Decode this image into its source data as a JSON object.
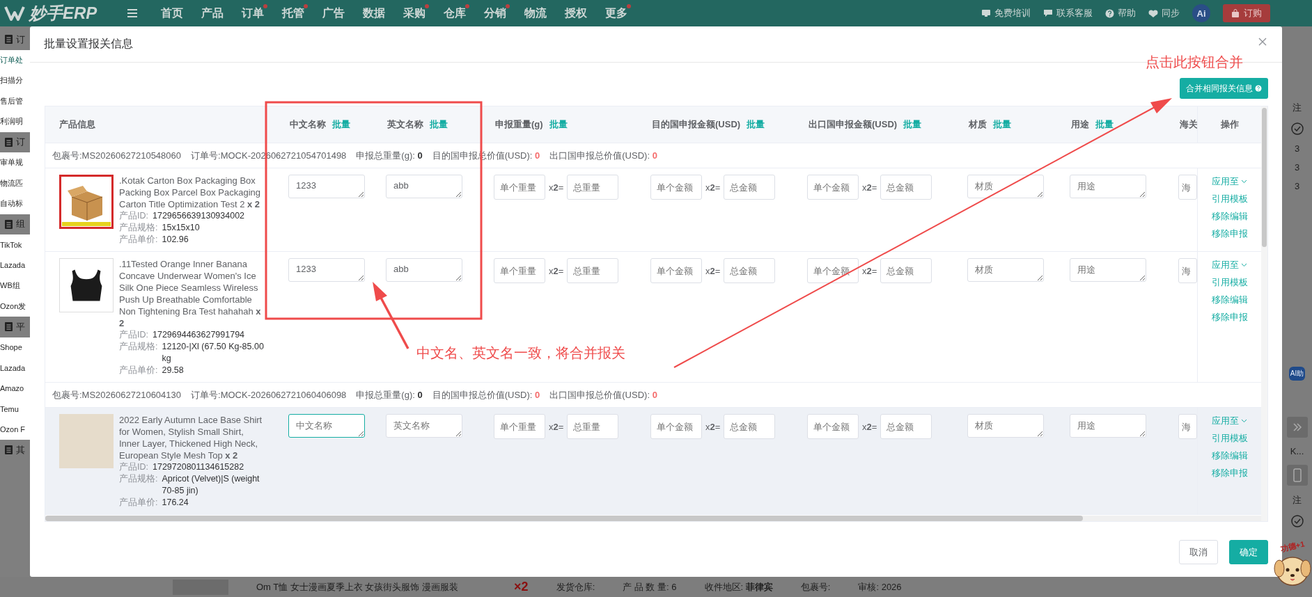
{
  "topbar": {
    "logo": "妙手ERP",
    "nav": [
      {
        "label": "首页",
        "badge": false
      },
      {
        "label": "产品",
        "badge": false
      },
      {
        "label": "订单",
        "badge": true
      },
      {
        "label": "托管",
        "badge": true
      },
      {
        "label": "广告",
        "badge": false
      },
      {
        "label": "数据",
        "badge": false
      },
      {
        "label": "采购",
        "badge": true
      },
      {
        "label": "仓库",
        "badge": true
      },
      {
        "label": "分销",
        "badge": true
      },
      {
        "label": "物流",
        "badge": false
      },
      {
        "label": "授权",
        "badge": false
      },
      {
        "label": "更多",
        "badge": true
      }
    ],
    "tools": [
      {
        "kind": "training",
        "label": "免费培训"
      },
      {
        "kind": "service",
        "label": "联系客服"
      },
      {
        "kind": "help",
        "label": "帮助"
      },
      {
        "kind": "sync",
        "label": "同步"
      }
    ],
    "ai": "Ai",
    "order_button": "订购"
  },
  "sidebar": [
    {
      "kind": "group",
      "label": "订"
    },
    {
      "kind": "item",
      "label": "订单处",
      "selected": true
    },
    {
      "kind": "item",
      "label": "扫描分",
      "selected": false
    },
    {
      "kind": "item",
      "label": "售后管",
      "selected": false
    },
    {
      "kind": "item",
      "label": "利润明",
      "selected": false
    },
    {
      "kind": "group",
      "label": "订"
    },
    {
      "kind": "item",
      "label": "审单规",
      "selected": false
    },
    {
      "kind": "item",
      "label": "物流匹",
      "selected": false
    },
    {
      "kind": "item",
      "label": "自动标",
      "selected": false
    },
    {
      "kind": "group",
      "label": "组"
    },
    {
      "kind": "item",
      "label": "TikTok",
      "selected": false
    },
    {
      "kind": "item",
      "label": "Lazada",
      "selected": false
    },
    {
      "kind": "item",
      "label": "WB组",
      "selected": false
    },
    {
      "kind": "item",
      "label": "Ozon发",
      "selected": false
    },
    {
      "kind": "group",
      "label": "平"
    },
    {
      "kind": "item",
      "label": "Shope",
      "selected": false
    },
    {
      "kind": "item",
      "label": "Lazada",
      "selected": false
    },
    {
      "kind": "item",
      "label": "Amazo",
      "selected": false
    },
    {
      "kind": "item",
      "label": "Temu",
      "selected": false
    },
    {
      "kind": "item",
      "label": "Ozon F",
      "selected": false
    },
    {
      "kind": "group",
      "label": "其"
    }
  ],
  "right_strip": [
    {
      "kind": "text",
      "text": "注"
    },
    {
      "kind": "check"
    },
    {
      "kind": "text",
      "text": "3"
    },
    {
      "kind": "text",
      "text": "3"
    },
    {
      "kind": "text",
      "text": "3"
    },
    {
      "kind": "ai",
      "text": "AI助"
    },
    {
      "kind": "expand"
    },
    {
      "kind": "text",
      "text": "K..."
    },
    {
      "kind": "phone"
    },
    {
      "kind": "text",
      "text": "注"
    },
    {
      "kind": "check"
    }
  ],
  "background_row": {
    "title": "Om T恤 女士漫画夏季上衣 女孩街头服饰 漫画服装",
    "quantity": "×2",
    "fields": [
      "发货仓库:",
      "产 品 数 量: 6",
      "收件地区: **菲律宾**",
      "包裹号:",
      "审核: 2026"
    ]
  },
  "modal": {
    "title": "批量设置报关信息",
    "merge_button": "合并相同报关信息",
    "columns": [
      {
        "label": "产品信息"
      },
      {
        "label": "中文名称",
        "batch": "批量"
      },
      {
        "label": "英文名称",
        "batch": "批量"
      },
      {
        "label": "申报重量(g)",
        "batch": "批量"
      },
      {
        "label": "目的国申报金额(USD)",
        "batch": "批量"
      },
      {
        "label": "出口国申报金额(USD)",
        "batch": "批量"
      },
      {
        "label": "材质",
        "batch": "批量"
      },
      {
        "label": "用途",
        "batch": "批量"
      },
      {
        "label": "海关"
      }
    ],
    "ops_header": "操作",
    "packages": [
      {
        "package_label": "包裹号:",
        "package_no": "MS20260627210548060",
        "order_label": "订单号:",
        "order_no": "MOCK-2026062721054701498",
        "weight_label": "申报总重量(g):",
        "weight": "0",
        "dest_label": "目的国申报总价值(USD):",
        "dest": "0",
        "export_label": "出口国申报总价值(USD):",
        "export": "0",
        "items": [
          {
            "kind": "carton",
            "hovered": false,
            "title": ".Kotak Carton Box Packaging Box Packing Box Parcel Box Packaging Carton Title Optimization Test 2 **x 2**",
            "meta": [
              {
                "label": "产品ID:",
                "value": "1729656639130934002"
              },
              {
                "label": "产品规格:",
                "value": "15x15x10"
              },
              {
                "label": "产品单价:",
                "value": "102.96"
              }
            ],
            "fields": [
              {
                "kind": "textarea",
                "value": "1233",
                "focused": false
              },
              {
                "kind": "textarea",
                "value": "abb",
                "focused": false
              },
              {
                "kind": "pair",
                "placeholder": "单个重量",
                "mult": "x**2**=",
                "total_placeholder": "总重量"
              },
              {
                "kind": "pair",
                "placeholder": "单个金额",
                "mult": "x**2**=",
                "total_placeholder": "总金额"
              },
              {
                "kind": "pair",
                "placeholder": "单个金额",
                "mult": "x**2**=",
                "total_placeholder": "总金额"
              },
              {
                "kind": "textarea",
                "placeholder": "材质",
                "focused": false
              },
              {
                "kind": "textarea",
                "placeholder": "用途",
                "focused": false
              },
              {
                "kind": "input",
                "placeholder": "海"
              }
            ],
            "ops": [
              {
                "kind": "dropdown",
                "label": "应用至"
              },
              {
                "kind": "link",
                "label": "引用模板"
              },
              {
                "kind": "link",
                "label": "移除编辑"
              },
              {
                "kind": "link",
                "label": "移除申报"
              }
            ]
          },
          {
            "kind": "top",
            "hovered": false,
            "title": ".11Tested Orange Inner Banana Concave Underwear Women's Ice Silk One Piece Seamless Wireless Push Up Breathable Comfortable Non Tightening Bra Test hahahah **x 2**",
            "meta": [
              {
                "label": "产品ID:",
                "value": "1729694463627991794"
              },
              {
                "label": "产品规格:",
                "value": "12120-|Xl (67.50 Kg-85.00 kg"
              },
              {
                "label": "产品单价:",
                "value": "29.58"
              }
            ],
            "fields": [
              {
                "kind": "textarea",
                "value": "1233",
                "focused": false
              },
              {
                "kind": "textarea",
                "value": "abb",
                "focused": false
              },
              {
                "kind": "pair",
                "placeholder": "单个重量",
                "mult": "x**2**=",
                "total_placeholder": "总重量"
              },
              {
                "kind": "pair",
                "placeholder": "单个金额",
                "mult": "x**2**=",
                "total_placeholder": "总金额"
              },
              {
                "kind": "pair",
                "placeholder": "单个金额",
                "mult": "x**2**=",
                "total_placeholder": "总金额"
              },
              {
                "kind": "textarea",
                "placeholder": "材质",
                "focused": false
              },
              {
                "kind": "textarea",
                "placeholder": "用途",
                "focused": false
              },
              {
                "kind": "input",
                "placeholder": "海"
              }
            ],
            "ops": [
              {
                "kind": "dropdown",
                "label": "应用至"
              },
              {
                "kind": "link",
                "label": "引用模板"
              },
              {
                "kind": "link",
                "label": "移除编辑"
              },
              {
                "kind": "link",
                "label": "移除申报"
              }
            ]
          }
        ]
      },
      {
        "package_label": "包裹号:",
        "package_no": "MS20260627210604130",
        "order_label": "订单号:",
        "order_no": "MOCK-2026062721060406098",
        "weight_label": "申报总重量(g):",
        "weight": "0",
        "dest_label": "目的国申报总价值(USD):",
        "dest": "0",
        "export_label": "出口国申报总价值(USD):",
        "export": "0",
        "items": [
          {
            "kind": "photo",
            "hovered": true,
            "title": "2022 Early Autumn Lace Base Shirt for Women, Stylish Small Shirt, Inner Layer, Thickened High Neck, European Style Mesh Top **x 2**",
            "meta": [
              {
                "label": "产品ID:",
                "value": "1729720801134615282"
              },
              {
                "label": "产品规格:",
                "value": "Apricot (Velvet)|S (weight 70-85 jin)"
              },
              {
                "label": "产品单价:",
                "value": "176.24"
              }
            ],
            "fields": [
              {
                "kind": "textarea",
                "placeholder": "中文名称",
                "focused": true
              },
              {
                "kind": "textarea",
                "placeholder": "英文名称",
                "focused": false
              },
              {
                "kind": "pair",
                "placeholder": "单个重量",
                "mult": "x**2**=",
                "total_placeholder": "总重量"
              },
              {
                "kind": "pair",
                "placeholder": "单个金额",
                "mult": "x**2**=",
                "total_placeholder": "总金额"
              },
              {
                "kind": "pair",
                "placeholder": "单个金额",
                "mult": "x**2**=",
                "total_placeholder": "总金额"
              },
              {
                "kind": "textarea",
                "placeholder": "材质",
                "focused": false
              },
              {
                "kind": "textarea",
                "placeholder": "用途",
                "focused": false
              },
              {
                "kind": "input",
                "placeholder": "海"
              }
            ],
            "ops": [
              {
                "kind": "dropdown",
                "label": "应用至"
              },
              {
                "kind": "link",
                "label": "引用模板"
              },
              {
                "kind": "link",
                "label": "移除编辑"
              },
              {
                "kind": "link",
                "label": "移除申报"
              }
            ]
          }
        ]
      }
    ],
    "cancel": "取消",
    "confirm": "确定"
  },
  "annotations": {
    "merge_hint": "点击此按钮合并",
    "name_hint": "中文名、英文名一致，将合并报关"
  },
  "sticker": "功德+1"
}
